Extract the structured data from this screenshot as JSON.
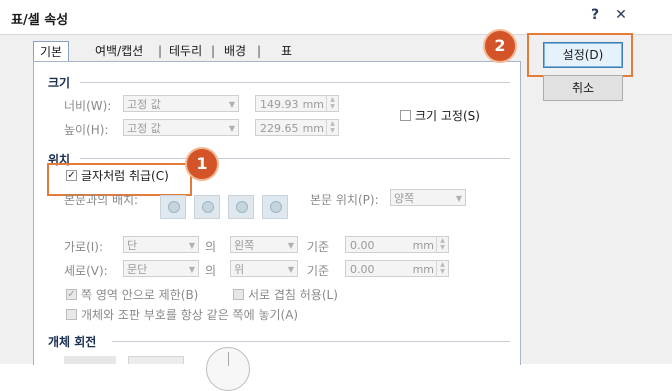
{
  "window": {
    "title": "표/셀 속성",
    "help_label": "?",
    "close_label": "✕"
  },
  "tabs": [
    {
      "label": "기본"
    },
    {
      "label": "여백/캡션"
    },
    {
      "label": "테두리"
    },
    {
      "label": "배경"
    },
    {
      "label": "표"
    }
  ],
  "tab_separator": "|",
  "size": {
    "section_label": "크기",
    "width_label": "너비(W):",
    "width_mode": "고정 값",
    "width_value": "149.93",
    "width_unit": "mm",
    "height_label": "높이(H):",
    "height_mode": "고정 값",
    "height_value": "229.65",
    "height_unit": "mm",
    "fix_size_label": "크기 고정(S)"
  },
  "position": {
    "section_label": "위치",
    "treat_as_char_label": "글자처럼 취급(C)",
    "text_layout_label": "본문과의 배치:",
    "text_pos_label": "본문 위치(P):",
    "text_pos_value": "양쪽",
    "horiz_label": "가로(I):",
    "horiz_ref": "단",
    "horiz_of": "의",
    "horiz_align": "왼쪽",
    "horiz_base": "기준",
    "horiz_offset": "0.00",
    "horiz_unit": "mm",
    "vert_label": "세로(V):",
    "vert_ref": "문단",
    "vert_of": "의",
    "vert_align": "위",
    "vert_base": "기준",
    "vert_offset": "0.00",
    "vert_unit": "mm",
    "limit_label": "쪽 영역 안으로 제한(B)",
    "overlap_label": "서로 겹침 허용(L)",
    "same_page_label": "개체와 조판 부호를 항상 같은 쪽에 놓기(A)"
  },
  "rotation": {
    "section_label": "개체 회전"
  },
  "buttons": {
    "ok_label": "설정(D)",
    "cancel_label": "취소"
  },
  "annotations": {
    "badge1": "1",
    "badge2": "2",
    "accent_color": "#d4542a"
  }
}
